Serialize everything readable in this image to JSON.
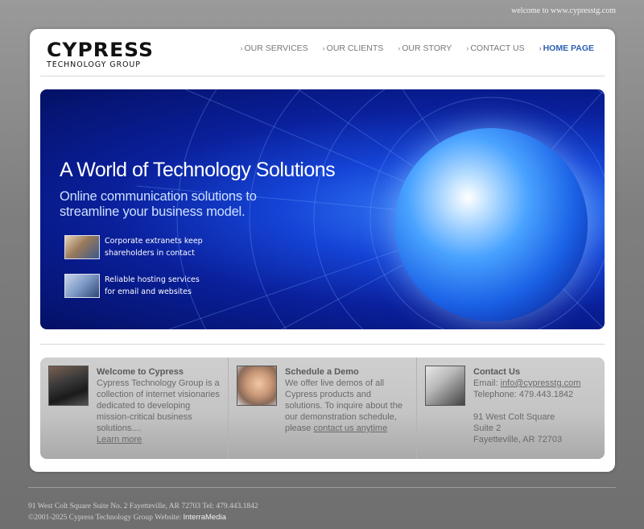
{
  "top": {
    "welcome": "welcome to www.cypresstg.com"
  },
  "logo": {
    "main": "CYPRESS",
    "sub": "TECHNOLOGY GROUP"
  },
  "nav": {
    "items": [
      {
        "label": "OUR SERVICES"
      },
      {
        "label": "OUR CLIENTS"
      },
      {
        "label": "OUR STORY"
      },
      {
        "label": "CONTACT US"
      },
      {
        "label": "HOME PAGE",
        "active": true
      }
    ]
  },
  "banner": {
    "title": "A World of Technology Solutions",
    "subtitle": "Online communication solutions to streamline your business model.",
    "features": [
      {
        "text": "Corporate extranets keep shareholders in contact"
      },
      {
        "text": "Reliable hosting services for email and websites"
      }
    ]
  },
  "info": {
    "welcome": {
      "heading": "Welcome to Cypress",
      "text": "Cypress Technology Group is a collection of internet visionaries dedicated to developing mission-critical business solutions....",
      "link": "Learn more"
    },
    "demo": {
      "heading": "Schedule a Demo",
      "text": "We offer live demos of all Cypress products and solutions. To inquire about the our demonstration schedule, please",
      "link": "contact us anytime"
    },
    "contact": {
      "heading": "Contact Us",
      "email_label": "Email:",
      "email": "info@cypresstg.com",
      "telephone": "Telephone: 479.443.1842",
      "address1": "91 West Colt Square",
      "address2": "Suite 2",
      "address3": "Fayetteville, AR 72703"
    }
  },
  "footer": {
    "line1": "91 West Colt Square Suite No. 2 Fayetteville, AR 72703 Tel: 479.443.1842",
    "line2": "©2001-2025 Cypress Technology Group Website:",
    "credit": "InterraMedia"
  },
  "colors": {
    "accent": "#2d5fb0",
    "banner": "#0a1f9a"
  }
}
